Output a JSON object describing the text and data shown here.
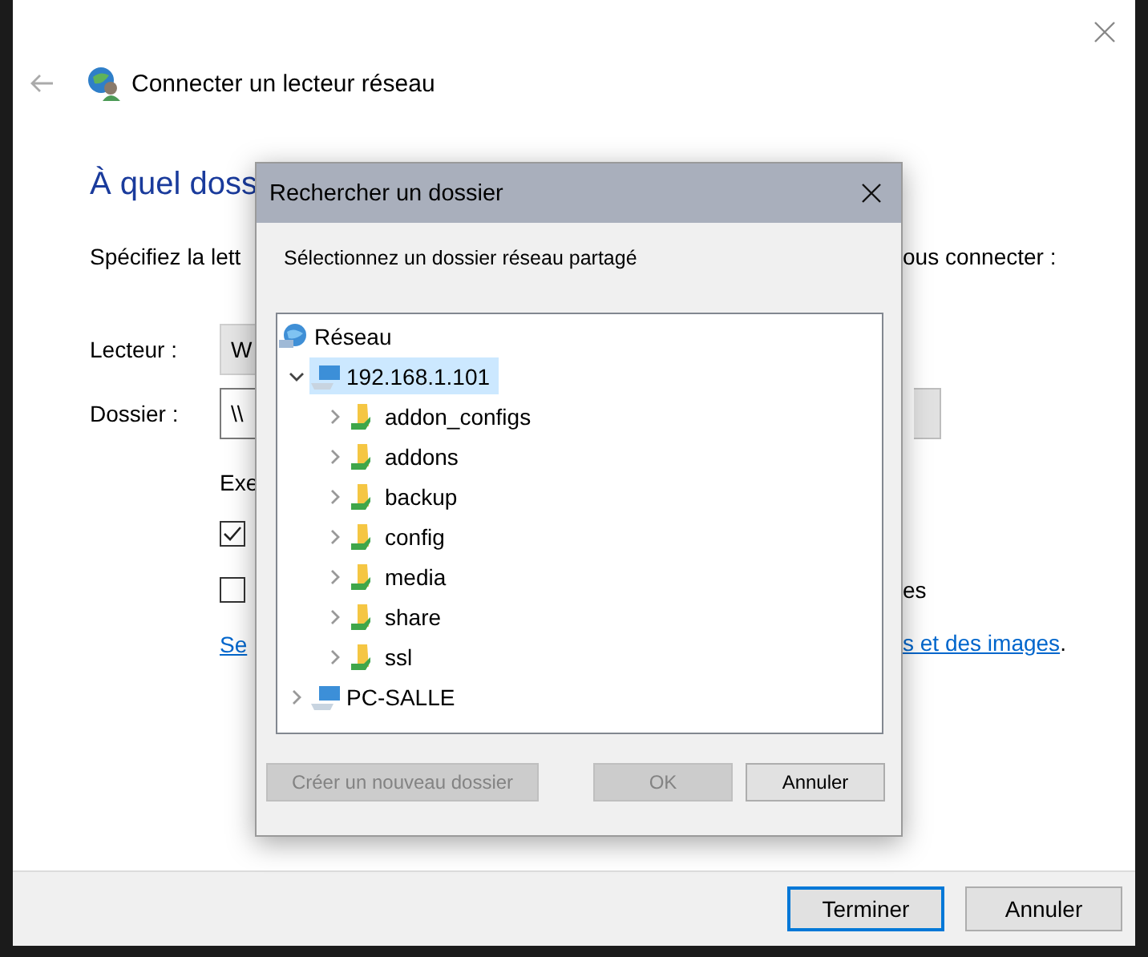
{
  "wizard": {
    "title": "Connecter un lecteur réseau",
    "heading": "À quel doss",
    "description": "Spécifiez la lett",
    "description_end": "ous connecter :",
    "drive_label": "Lecteur :",
    "drive_value": "W",
    "folder_label": "Dossier :",
    "folder_value": "\\\\",
    "options_label": "Exe",
    "options": [
      {
        "checked": true
      },
      {
        "checked": false,
        "label_end": "es"
      }
    ],
    "link_start": "Se",
    "link_end": "s et des images",
    "link_period": ".",
    "buttons": [
      {
        "label": "Terminer",
        "default": true
      },
      {
        "label": "Annuler",
        "default": false
      }
    ]
  },
  "dialog": {
    "title": "Rechercher un dossier",
    "instruction": "Sélectionnez un dossier réseau partagé",
    "tree": [
      {
        "label": "Réseau",
        "kind": "network",
        "children": [
          {
            "label": "192.168.1.101",
            "kind": "computer",
            "expanded": true,
            "selected": true,
            "children": [
              {
                "label": "addon_configs",
                "kind": "share",
                "expanded": false,
                "selected": false
              },
              {
                "label": "addons",
                "kind": "share",
                "expanded": false,
                "selected": false
              },
              {
                "label": "backup",
                "kind": "share",
                "expanded": false,
                "selected": false
              },
              {
                "label": "config",
                "kind": "share",
                "expanded": false,
                "selected": false
              },
              {
                "label": "media",
                "kind": "share",
                "expanded": false,
                "selected": false
              },
              {
                "label": "share",
                "kind": "share",
                "expanded": false,
                "selected": false
              },
              {
                "label": "ssl",
                "kind": "share",
                "expanded": false,
                "selected": false
              }
            ]
          },
          {
            "label": "PC-SALLE",
            "kind": "computer",
            "expanded": false,
            "selected": false
          }
        ]
      }
    ],
    "buttons": [
      {
        "label": "Créer un nouveau dossier",
        "disabled": true
      },
      {
        "label": "OK",
        "disabled": true
      },
      {
        "label": "Annuler",
        "disabled": false
      }
    ]
  }
}
